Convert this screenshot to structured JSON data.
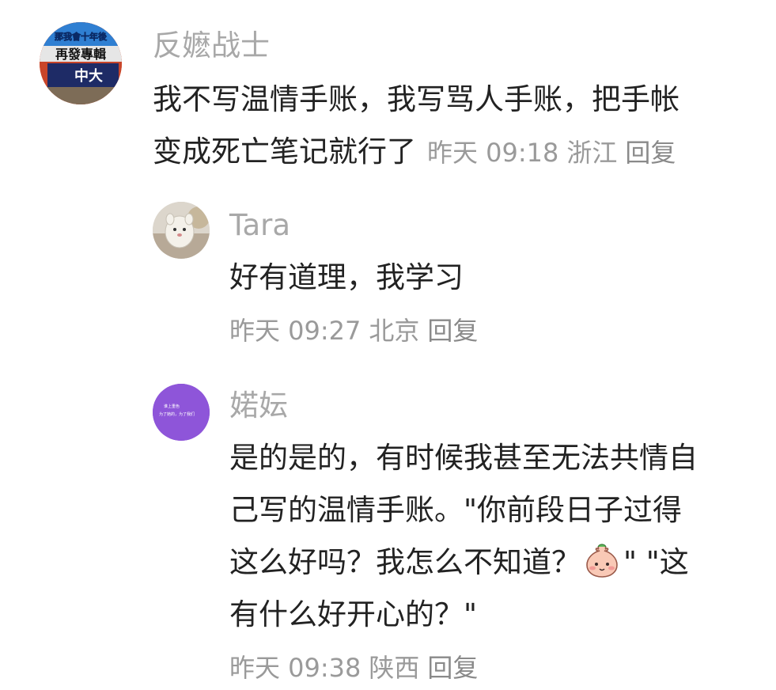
{
  "comments": [
    {
      "username": "反嬷战士",
      "avatar_text": [
        "那我會十年後",
        "再發專輯",
        "中大"
      ],
      "text_lines": [
        "我不写温情手账，我写骂人手账，把手帐",
        "变成死亡笔记就行了"
      ],
      "time": "昨天 09:18",
      "location": "浙江",
      "reply": "回复"
    },
    {
      "username": "Tara",
      "text_lines": [
        "好有道理，我学习"
      ],
      "time": "昨天 09:27",
      "location": "北京",
      "reply": "回复"
    },
    {
      "username": "婼妘",
      "avatar_text": [
        "谁上重色",
        "为了她的，为了我们"
      ],
      "text_lines": [
        "是的是的，有时候我甚至无法共情自",
        "己写的温情手账。\"你前段日子过得",
        "这么好吗？我怎么不知道？",
        "\" \"这",
        "有什么好开心的？\""
      ],
      "emoji": "shy-face-emoji",
      "time": "昨天 09:38",
      "location": "陕西",
      "reply": "回复"
    }
  ],
  "colors": {
    "name": "#a8a8a8",
    "text": "#222222",
    "meta": "#9a9a9a",
    "avatar_purple": "#8e55d9"
  }
}
